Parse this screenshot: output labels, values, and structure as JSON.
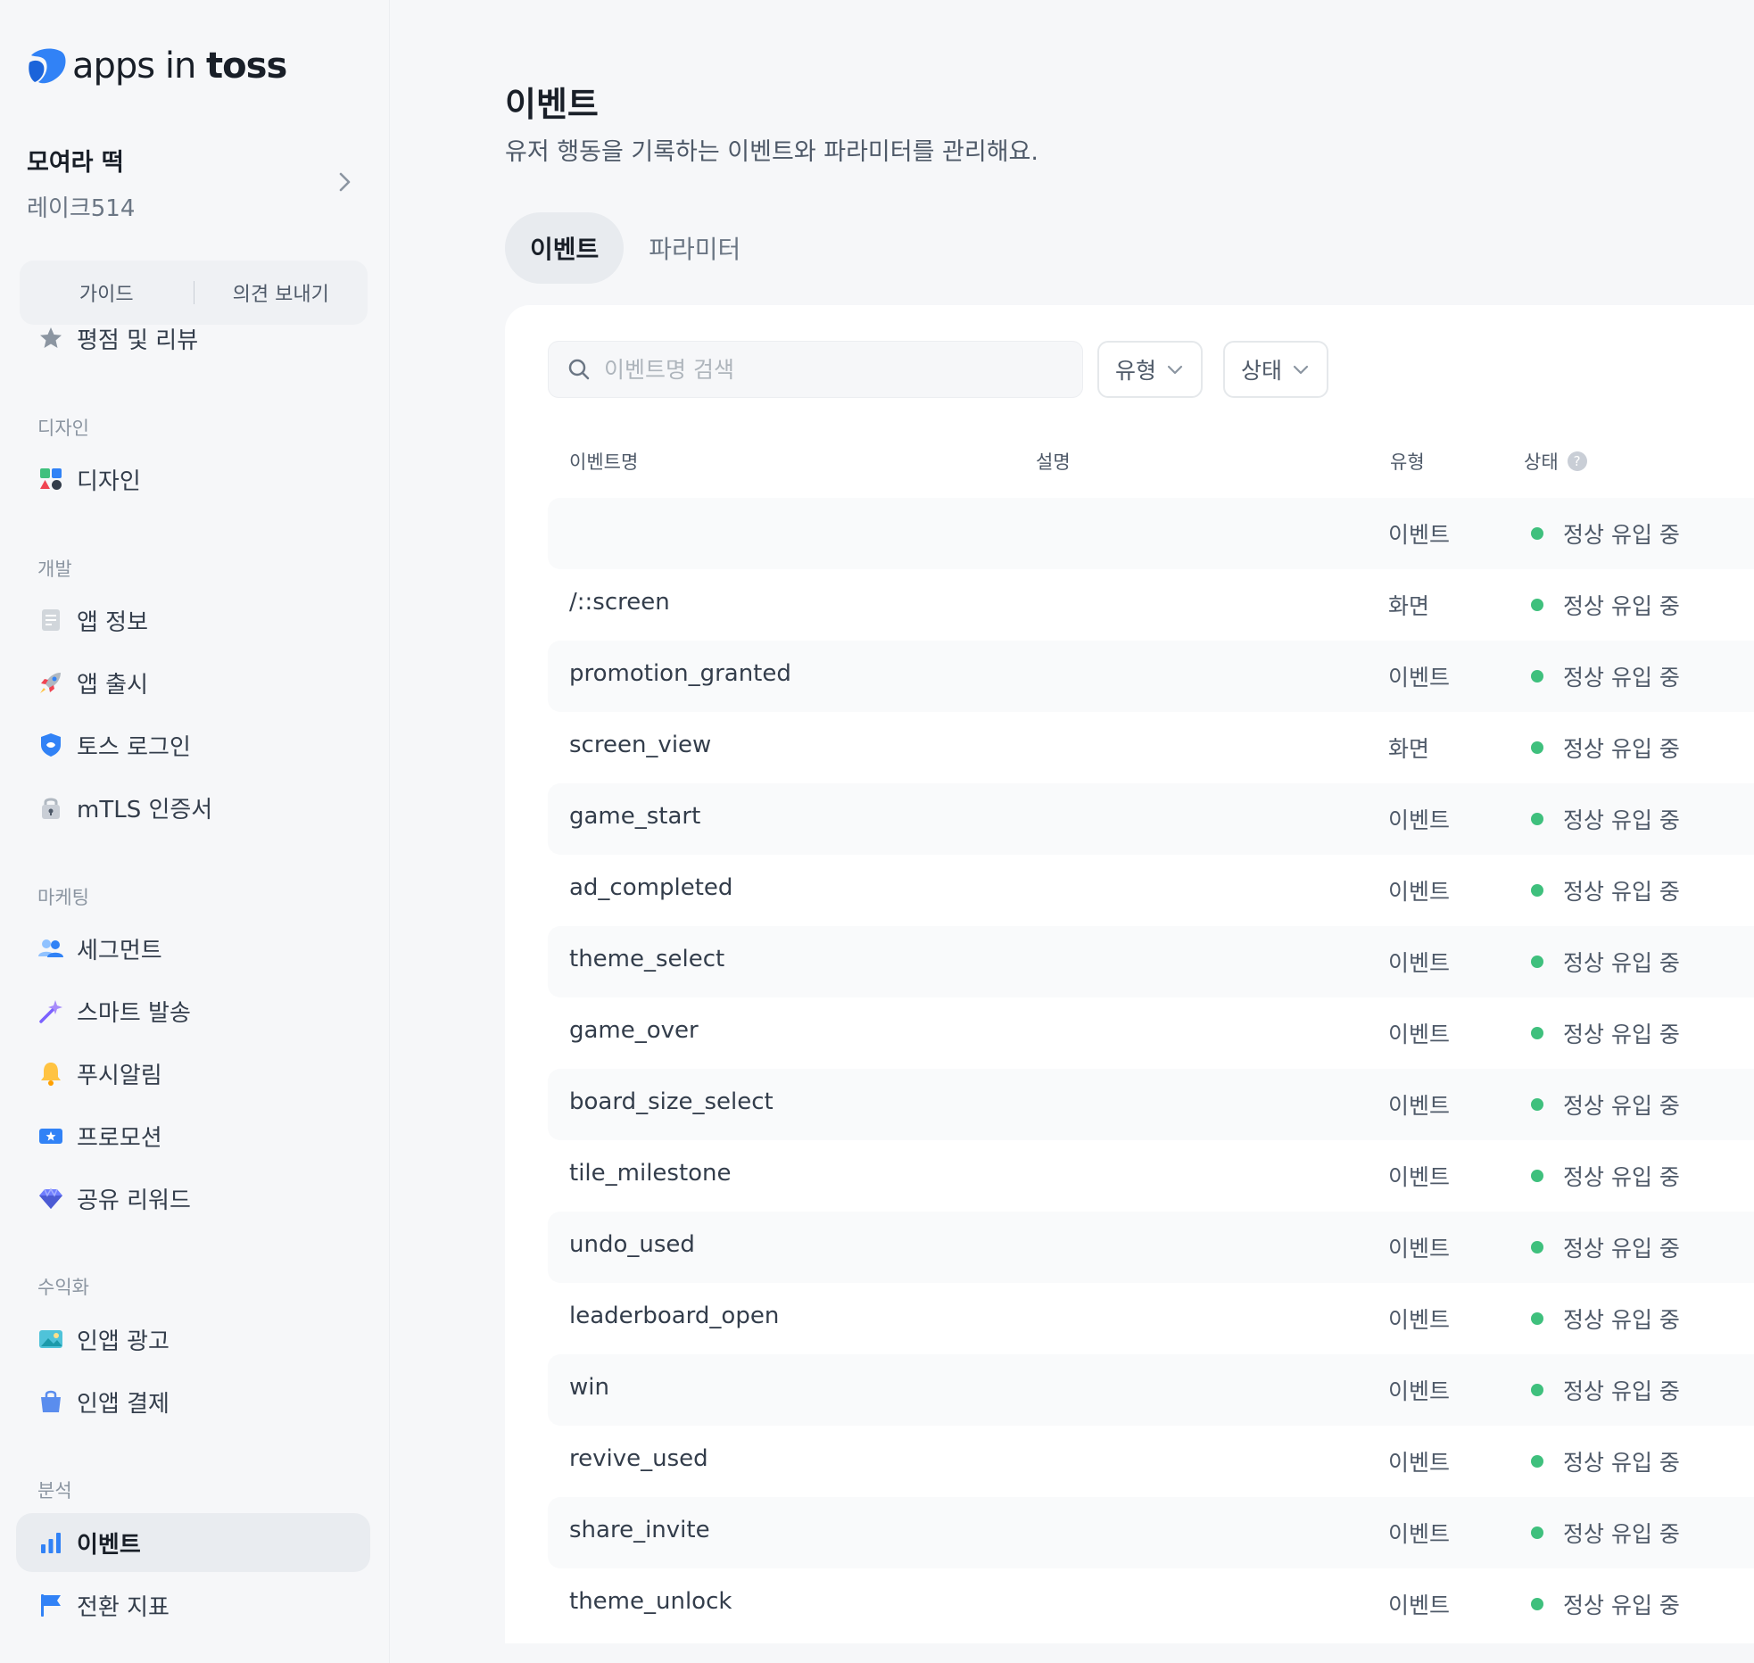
{
  "brand": {
    "logo_prefix": "apps in ",
    "logo_bold": "toss"
  },
  "app": {
    "name": "모여라 떡",
    "developer": "레이크514"
  },
  "guide_bar": {
    "guide": "가이드",
    "feedback": "의견 보내기"
  },
  "sidebar": {
    "top_item": "평점 및 리뷰",
    "sections": {
      "design": "디자인",
      "dev": "개발",
      "marketing": "마케팅",
      "monetization": "수익화",
      "analytics": "분석"
    },
    "items": {
      "design": "디자인",
      "app_info": "앱 정보",
      "app_release": "앱 출시",
      "toss_login": "토스 로그인",
      "mtls": "mTLS 인증서",
      "segment": "세그먼트",
      "smart_send": "스마트 발송",
      "push": "푸시알림",
      "promotion": "프로모션",
      "share_reward": "공유 리워드",
      "inapp_ads": "인앱 광고",
      "inapp_payment": "인앱 결제",
      "events": "이벤트",
      "conversion": "전환 지표"
    }
  },
  "page": {
    "title": "이벤트",
    "description": "유저 행동을 기록하는 이벤트와 파라미터를 관리해요.",
    "tabs": [
      "이벤트",
      "파라미터"
    ]
  },
  "search": {
    "placeholder": "이벤트명 검색"
  },
  "filters": {
    "type": "유형",
    "status": "상태"
  },
  "table": {
    "headers": {
      "name": "이벤트명",
      "description": "설명",
      "type": "유형",
      "status": "상태"
    },
    "rows": [
      {
        "name": "",
        "type": "이벤트",
        "status": "정상 유입 중"
      },
      {
        "name": "/::screen",
        "type": "화면",
        "status": "정상 유입 중"
      },
      {
        "name": "promotion_granted",
        "type": "이벤트",
        "status": "정상 유입 중"
      },
      {
        "name": "screen_view",
        "type": "화면",
        "status": "정상 유입 중"
      },
      {
        "name": "game_start",
        "type": "이벤트",
        "status": "정상 유입 중"
      },
      {
        "name": "ad_completed",
        "type": "이벤트",
        "status": "정상 유입 중"
      },
      {
        "name": "theme_select",
        "type": "이벤트",
        "status": "정상 유입 중"
      },
      {
        "name": "game_over",
        "type": "이벤트",
        "status": "정상 유입 중"
      },
      {
        "name": "board_size_select",
        "type": "이벤트",
        "status": "정상 유입 중"
      },
      {
        "name": "tile_milestone",
        "type": "이벤트",
        "status": "정상 유입 중"
      },
      {
        "name": "undo_used",
        "type": "이벤트",
        "status": "정상 유입 중"
      },
      {
        "name": "leaderboard_open",
        "type": "이벤트",
        "status": "정상 유입 중"
      },
      {
        "name": "win",
        "type": "이벤트",
        "status": "정상 유입 중"
      },
      {
        "name": "revive_used",
        "type": "이벤트",
        "status": "정상 유입 중"
      },
      {
        "name": "share_invite",
        "type": "이벤트",
        "status": "정상 유입 중"
      },
      {
        "name": "theme_unlock",
        "type": "이벤트",
        "status": "정상 유입 중"
      }
    ]
  },
  "colors": {
    "status_ok": "#3fc07d",
    "brand_blue": "#3182f6",
    "active_bg": "#e9ecf0"
  }
}
